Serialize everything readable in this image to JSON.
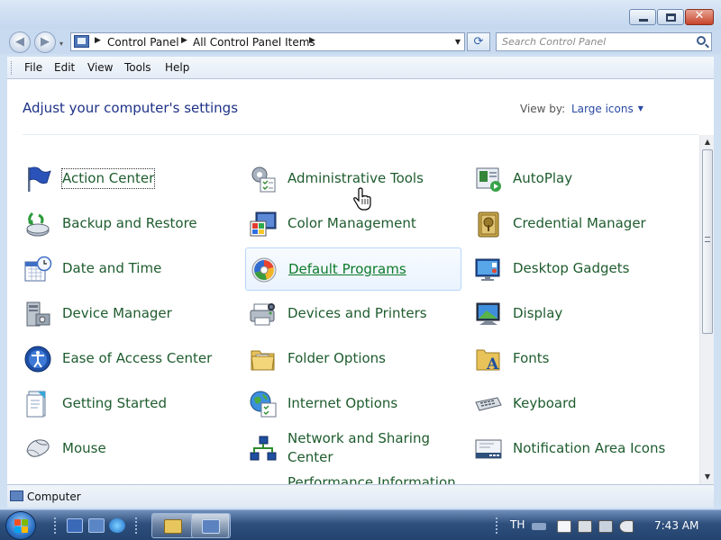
{
  "window": {
    "nav": {
      "back_glyph": "◀",
      "forward_glyph": "▶",
      "dropdown_glyph": "▾"
    },
    "breadcrumb": [
      {
        "label": "Control Panel"
      },
      {
        "label": "All Control Panel Items"
      }
    ],
    "refresh_glyph": "⟳",
    "search": {
      "placeholder": "Search Control Panel"
    },
    "menu": [
      {
        "label": "File"
      },
      {
        "label": "Edit"
      },
      {
        "label": "View"
      },
      {
        "label": "Tools"
      },
      {
        "label": "Help"
      }
    ]
  },
  "content": {
    "heading": "Adjust your computer's settings",
    "view_by_label": "View by:",
    "view_by_value": "Large icons",
    "items": [
      {
        "label": "Action Center",
        "icon": "flag-icon"
      },
      {
        "label": "Administrative Tools",
        "icon": "admin-tools-icon"
      },
      {
        "label": "AutoPlay",
        "icon": "autoplay-icon"
      },
      {
        "label": "Backup and Restore",
        "icon": "backup-icon"
      },
      {
        "label": "Color Management",
        "icon": "color-management-icon"
      },
      {
        "label": "Credential Manager",
        "icon": "vault-icon"
      },
      {
        "label": "Date and Time",
        "icon": "calendar-clock-icon"
      },
      {
        "label": "Default Programs",
        "icon": "default-programs-icon"
      },
      {
        "label": "Desktop Gadgets",
        "icon": "gadgets-icon"
      },
      {
        "label": "Device Manager",
        "icon": "device-manager-icon"
      },
      {
        "label": "Devices and Printers",
        "icon": "printer-icon"
      },
      {
        "label": "Display",
        "icon": "monitor-icon"
      },
      {
        "label": "Ease of Access Center",
        "icon": "ease-of-access-icon"
      },
      {
        "label": "Folder Options",
        "icon": "folder-icon"
      },
      {
        "label": "Fonts",
        "icon": "fonts-icon"
      },
      {
        "label": "Getting Started",
        "icon": "getting-started-icon"
      },
      {
        "label": "Internet Options",
        "icon": "internet-icon"
      },
      {
        "label": "Keyboard",
        "icon": "keyboard-icon"
      },
      {
        "label": "Mouse",
        "icon": "mouse-icon"
      },
      {
        "label": "Network and Sharing\nCenter",
        "icon": "network-icon"
      },
      {
        "label": "Notification Area Icons",
        "icon": "notification-icon"
      },
      {
        "label": "Performance Information",
        "icon": "performance-icon"
      }
    ]
  },
  "statusbar": {
    "text": "Computer"
  },
  "taskbar": {
    "language": "TH",
    "clock": "7:43 AM"
  },
  "colors": {
    "link_green": "#1e5c2e",
    "heading_blue": "#1e3287",
    "taskbar_blue": "#2e4f7c"
  }
}
